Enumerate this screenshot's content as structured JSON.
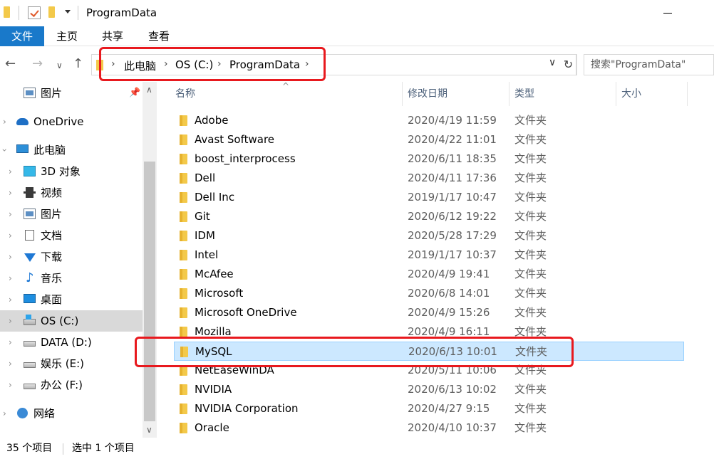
{
  "window": {
    "title": "ProgramData"
  },
  "ribbon": {
    "tabs": [
      "文件",
      "主页",
      "共享",
      "查看"
    ]
  },
  "address": {
    "crumbs": [
      "此电脑",
      "OS (C:)",
      "ProgramData"
    ],
    "search_placeholder": "搜索\"ProgramData\""
  },
  "sidebar": {
    "items": [
      {
        "label": "图片",
        "icon": "pictures-icon",
        "pinned": true
      },
      {
        "label": "OneDrive",
        "icon": "onedrive-icon"
      },
      {
        "label": "此电脑",
        "icon": "this-pc-icon",
        "expanded": true
      },
      {
        "label": "3D 对象",
        "icon": "3d-objects-icon"
      },
      {
        "label": "视频",
        "icon": "videos-icon"
      },
      {
        "label": "图片",
        "icon": "pictures-icon"
      },
      {
        "label": "文档",
        "icon": "documents-icon"
      },
      {
        "label": "下载",
        "icon": "downloads-icon"
      },
      {
        "label": "音乐",
        "icon": "music-icon"
      },
      {
        "label": "桌面",
        "icon": "desktop-icon"
      },
      {
        "label": "OS (C:)",
        "icon": "os-drive-icon",
        "selected": true
      },
      {
        "label": "DATA (D:)",
        "icon": "drive-icon"
      },
      {
        "label": "娱乐 (E:)",
        "icon": "drive-icon"
      },
      {
        "label": "办公 (F:)",
        "icon": "drive-icon"
      },
      {
        "label": "网络",
        "icon": "network-icon"
      }
    ]
  },
  "filelist": {
    "columns": [
      "名称",
      "修改日期",
      "类型",
      "大小"
    ],
    "rows": [
      {
        "name": "Adobe",
        "date": "2020/4/19 11:59",
        "type": "文件夹"
      },
      {
        "name": "Avast Software",
        "date": "2020/4/22 11:01",
        "type": "文件夹"
      },
      {
        "name": "boost_interprocess",
        "date": "2020/6/11 18:35",
        "type": "文件夹"
      },
      {
        "name": "Dell",
        "date": "2020/4/11 17:36",
        "type": "文件夹"
      },
      {
        "name": "Dell Inc",
        "date": "2019/1/17 10:47",
        "type": "文件夹"
      },
      {
        "name": "Git",
        "date": "2020/6/12 19:22",
        "type": "文件夹"
      },
      {
        "name": "IDM",
        "date": "2020/5/28 17:29",
        "type": "文件夹"
      },
      {
        "name": "Intel",
        "date": "2019/1/17 10:37",
        "type": "文件夹"
      },
      {
        "name": "McAfee",
        "date": "2020/4/9 19:41",
        "type": "文件夹"
      },
      {
        "name": "Microsoft",
        "date": "2020/6/8 14:01",
        "type": "文件夹"
      },
      {
        "name": "Microsoft OneDrive",
        "date": "2020/4/9 15:26",
        "type": "文件夹"
      },
      {
        "name": "Mozilla",
        "date": "2020/4/9 16:11",
        "type": "文件夹"
      },
      {
        "name": "MySQL",
        "date": "2020/6/13 10:01",
        "type": "文件夹",
        "selected": true
      },
      {
        "name": "NetEaseWinDA",
        "date": "2020/5/11 10:06",
        "type": "文件夹"
      },
      {
        "name": "NVIDIA",
        "date": "2020/6/13 10:02",
        "type": "文件夹"
      },
      {
        "name": "NVIDIA Corporation",
        "date": "2020/4/27 9:15",
        "type": "文件夹"
      },
      {
        "name": "Oracle",
        "date": "2020/4/10 10:37",
        "type": "文件夹"
      }
    ]
  },
  "status": {
    "count": "35 个项目",
    "selection": "选中 1 个项目"
  },
  "colors": {
    "accent": "#1979ca",
    "selection_bg": "#cce8ff",
    "annotation": "#e8191e"
  }
}
